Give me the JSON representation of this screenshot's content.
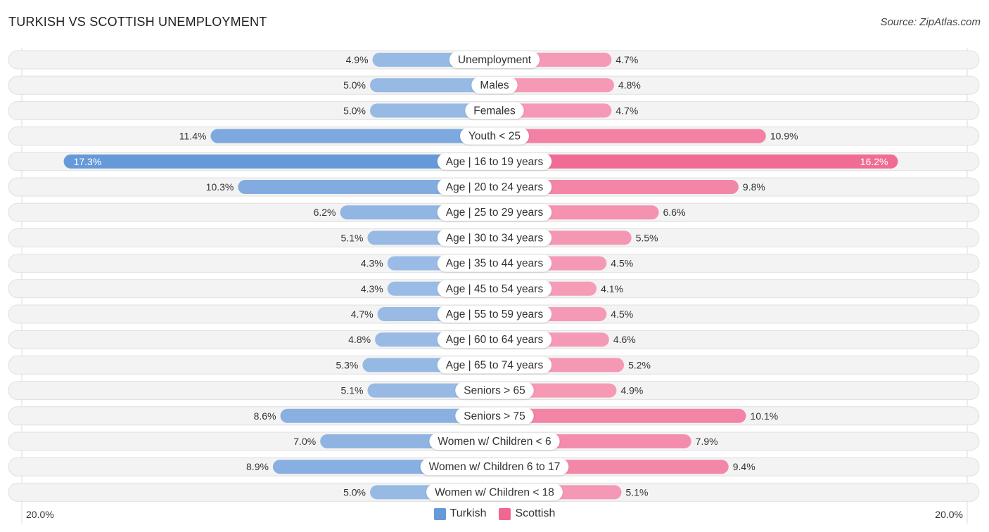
{
  "header": {
    "title": "TURKISH VS SCOTTISH UNEMPLOYMENT",
    "source": "Source: ZipAtlas.com"
  },
  "axis": {
    "left_label": "20.0%",
    "right_label": "20.0%"
  },
  "legend": [
    {
      "name": "Turkish",
      "color": "#6699d8"
    },
    {
      "name": "Scottish",
      "color": "#f06892"
    }
  ],
  "chart_data": {
    "type": "bar",
    "orientation": "horizontal-diverging",
    "title": "TURKISH VS SCOTTISH UNEMPLOYMENT",
    "xlabel": "",
    "ylabel": "",
    "xlim": [
      -20,
      20
    ],
    "unit": "%",
    "categories": [
      "Unemployment",
      "Males",
      "Females",
      "Youth < 25",
      "Age | 16 to 19 years",
      "Age | 20 to 24 years",
      "Age | 25 to 29 years",
      "Age | 30 to 34 years",
      "Age | 35 to 44 years",
      "Age | 45 to 54 years",
      "Age | 55 to 59 years",
      "Age | 60 to 64 years",
      "Age | 65 to 74 years",
      "Seniors > 65",
      "Seniors > 75",
      "Women w/ Children < 6",
      "Women w/ Children 6 to 17",
      "Women w/ Children < 18"
    ],
    "series": [
      {
        "name": "Turkish",
        "color": "#6699d8",
        "values": [
          4.9,
          5.0,
          5.0,
          11.4,
          17.3,
          10.3,
          6.2,
          5.1,
          4.3,
          4.3,
          4.7,
          4.8,
          5.3,
          5.1,
          8.6,
          7.0,
          8.9,
          5.0
        ],
        "labels": [
          "4.9%",
          "5.0%",
          "5.0%",
          "11.4%",
          "17.3%",
          "10.3%",
          "6.2%",
          "5.1%",
          "4.3%",
          "4.3%",
          "4.7%",
          "4.8%",
          "5.3%",
          "5.1%",
          "8.6%",
          "7.0%",
          "8.9%",
          "5.0%"
        ]
      },
      {
        "name": "Scottish",
        "color": "#f06892",
        "values": [
          4.7,
          4.8,
          4.7,
          10.9,
          16.2,
          9.8,
          6.6,
          5.5,
          4.5,
          4.1,
          4.5,
          4.6,
          5.2,
          4.9,
          10.1,
          7.9,
          9.4,
          5.1
        ],
        "labels": [
          "4.7%",
          "4.8%",
          "4.7%",
          "10.9%",
          "16.2%",
          "9.8%",
          "6.6%",
          "5.5%",
          "4.5%",
          "4.1%",
          "4.5%",
          "4.6%",
          "5.2%",
          "4.9%",
          "10.1%",
          "7.9%",
          "9.4%",
          "5.1%"
        ]
      }
    ],
    "legend_position": "bottom-center",
    "grid": false
  }
}
